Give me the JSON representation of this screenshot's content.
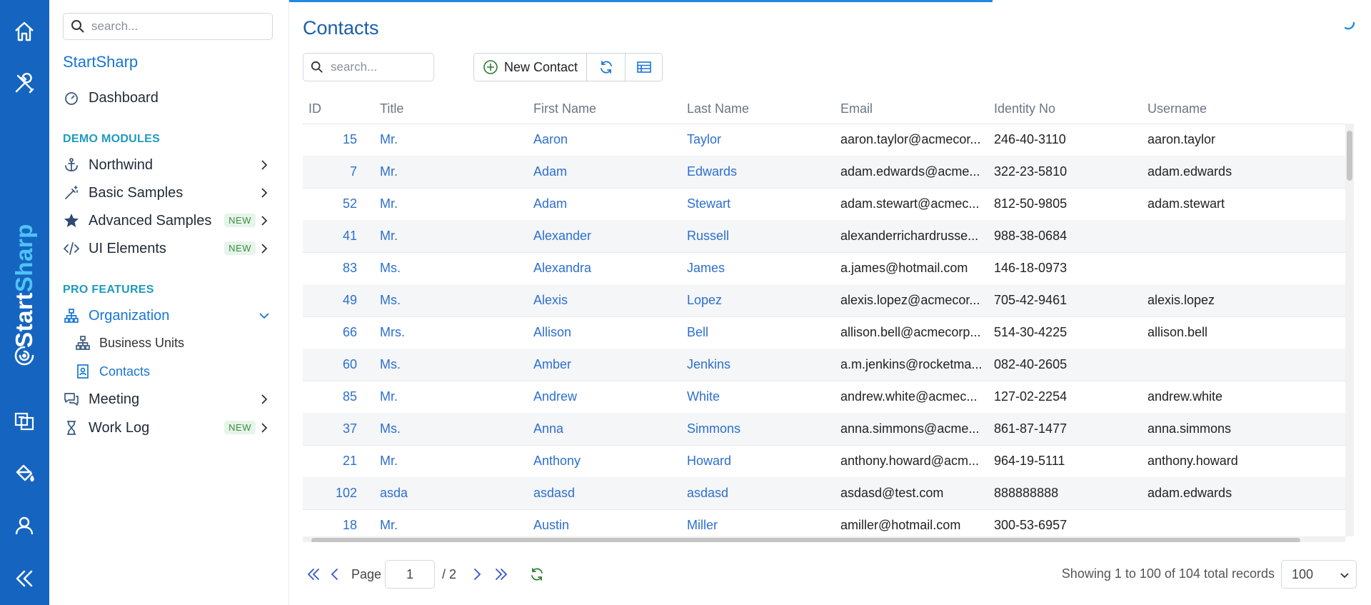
{
  "brand": {
    "part1": "Start",
    "part2": "Sharp"
  },
  "sidebar": {
    "search_placeholder": "search...",
    "app_title": "StartSharp",
    "dashboard": "Dashboard",
    "section_demo": "DEMO MODULES",
    "section_pro": "PRO FEATURES",
    "items": [
      {
        "label": "Northwind",
        "badge": ""
      },
      {
        "label": "Basic Samples",
        "badge": ""
      },
      {
        "label": "Advanced Samples",
        "badge": "NEW"
      },
      {
        "label": "UI Elements",
        "badge": "NEW"
      },
      {
        "label": "Organization",
        "badge": ""
      },
      {
        "label": "Meeting",
        "badge": ""
      },
      {
        "label": "Work Log",
        "badge": "NEW"
      }
    ],
    "sub_items": [
      {
        "label": "Business Units"
      },
      {
        "label": "Contacts"
      }
    ]
  },
  "main": {
    "title": "Contacts",
    "search_placeholder": "search...",
    "new_button": "New Contact"
  },
  "table": {
    "columns": [
      "ID",
      "Title",
      "First Name",
      "Last Name",
      "Email",
      "Identity No",
      "Username"
    ],
    "rows": [
      [
        "15",
        "Mr.",
        "Aaron",
        "Taylor",
        "aaron.taylor@acmecor...",
        "246-40-3110",
        "aaron.taylor"
      ],
      [
        "7",
        "Mr.",
        "Adam",
        "Edwards",
        "adam.edwards@acme...",
        "322-23-5810",
        "adam.edwards"
      ],
      [
        "52",
        "Mr.",
        "Adam",
        "Stewart",
        "adam.stewart@acmec...",
        "812-50-9805",
        "adam.stewart"
      ],
      [
        "41",
        "Mr.",
        "Alexander",
        "Russell",
        "alexanderrichardrusse...",
        "988-38-0684",
        ""
      ],
      [
        "83",
        "Ms.",
        "Alexandra",
        "James",
        "a.james@hotmail.com",
        "146-18-0973",
        ""
      ],
      [
        "49",
        "Ms.",
        "Alexis",
        "Lopez",
        "alexis.lopez@acmecor...",
        "705-42-9461",
        "alexis.lopez"
      ],
      [
        "66",
        "Mrs.",
        "Allison",
        "Bell",
        "allison.bell@acmecorp...",
        "514-30-4225",
        "allison.bell"
      ],
      [
        "60",
        "Ms.",
        "Amber",
        "Jenkins",
        "a.m.jenkins@rocketma...",
        "082-40-2605",
        ""
      ],
      [
        "85",
        "Mr.",
        "Andrew",
        "White",
        "andrew.white@acmec...",
        "127-02-2254",
        "andrew.white"
      ],
      [
        "37",
        "Ms.",
        "Anna",
        "Simmons",
        "anna.simmons@acme...",
        "861-87-1477",
        "anna.simmons"
      ],
      [
        "21",
        "Mr.",
        "Anthony",
        "Howard",
        "anthony.howard@acm...",
        "964-19-5111",
        "anthony.howard"
      ],
      [
        "102",
        "asda",
        "asdasd",
        "asdasd",
        "asdasd@test.com",
        "888888888",
        "adam.edwards"
      ],
      [
        "18",
        "Mr.",
        "Austin",
        "Miller",
        "amiller@hotmail.com",
        "300-53-6957",
        ""
      ]
    ]
  },
  "pager": {
    "page_label": "Page",
    "page_value": "1",
    "page_total": "/ 2",
    "status": "Showing 1 to 100 of 104 total records",
    "page_size": "100"
  },
  "colors": {
    "rail": "#1565c0",
    "accent": "#1976d2",
    "link": "#2d6fcf"
  }
}
